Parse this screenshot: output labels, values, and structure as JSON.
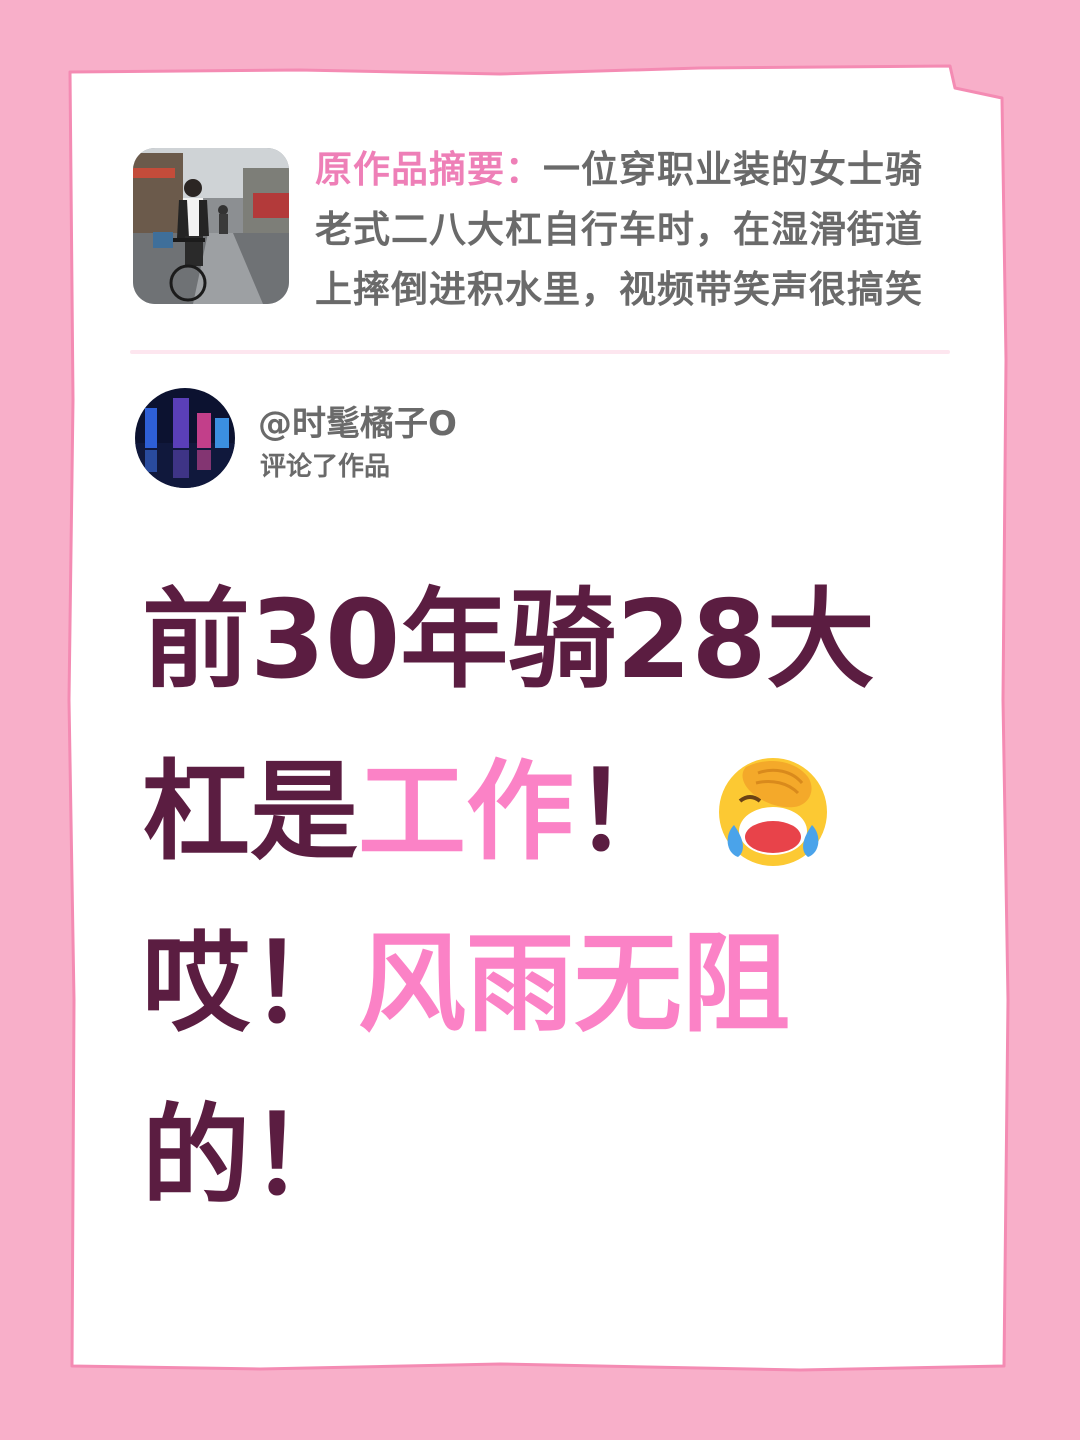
{
  "summary": {
    "label": "原作品摘要：",
    "text": "一位穿职业装的女士骑老式二八大杠自行车时，在湿滑街道上摔倒进积水里，视频带笑声很搞笑"
  },
  "user": {
    "name": "@时髦橘子O",
    "action": "评论了作品"
  },
  "headline": {
    "part1": "前30年骑28大杠是",
    "part2": "工作",
    "part3": "！",
    "part4": "哎！",
    "part5": "风雨无阻",
    "part6": "的！"
  },
  "icons": {
    "emoji": "facepalm-laughing-crying-emoji"
  },
  "colors": {
    "background": "#f8afc9",
    "card": "#ffffff",
    "label_pink": "#ee7fb7",
    "headline_dark": "#5b1d41",
    "headline_highlight": "#fb82c6",
    "gray_text": "#6a6a6a"
  }
}
